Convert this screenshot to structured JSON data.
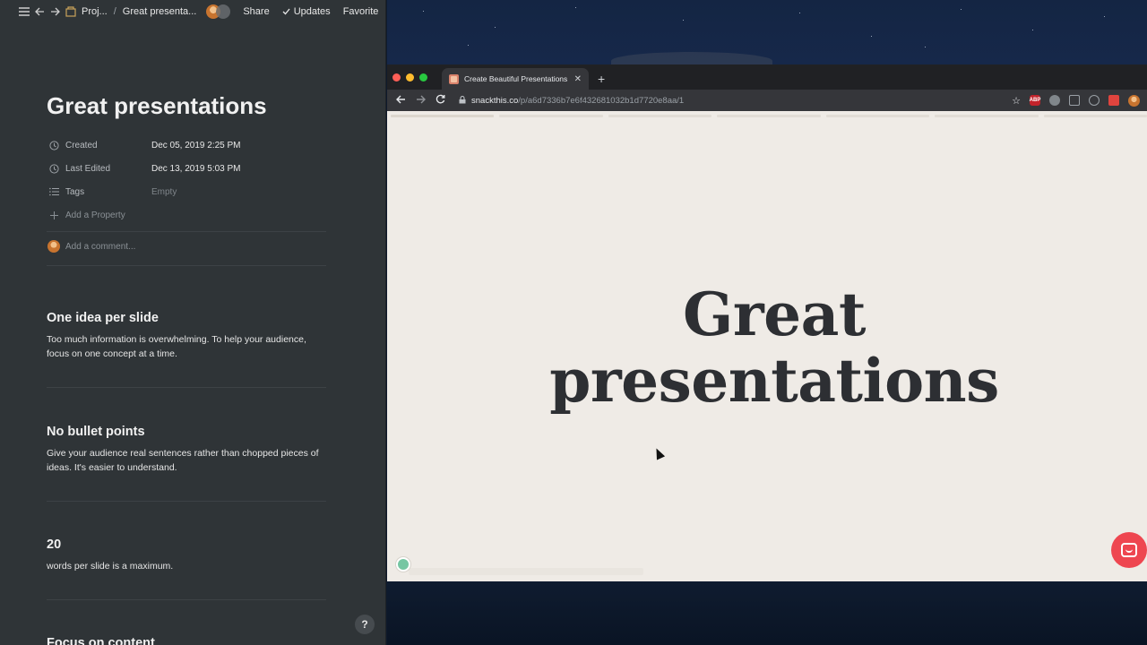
{
  "notion": {
    "breadcrumb": [
      "Proj...",
      "Great presenta..."
    ],
    "topbar_actions": {
      "share": "Share",
      "updates": "Updates",
      "favorite": "Favorite"
    },
    "page_title": "Great presentations",
    "properties": [
      {
        "icon": "clock-icon",
        "name": "Created",
        "value": "Dec 05, 2019 2:25 PM",
        "empty": false
      },
      {
        "icon": "clock-icon",
        "name": "Last Edited",
        "value": "Dec 13, 2019 5:03 PM",
        "empty": false
      },
      {
        "icon": "list-icon",
        "name": "Tags",
        "value": "Empty",
        "empty": true
      }
    ],
    "add_property": "Add a Property",
    "comment_placeholder": "Add a comment...",
    "blocks": [
      {
        "heading": "One idea per slide",
        "body": "Too much information is overwhelming. To help your audience, focus on one concept at a time."
      },
      {
        "heading": "No bullet points",
        "body": "Give your audience real sentences rather than chopped pieces of ideas. It's easier to understand."
      },
      {
        "heading": "20",
        "body": "words per slide is a maximum."
      },
      {
        "heading": "Focus on content",
        "body": ""
      }
    ],
    "help_label": "?"
  },
  "browser": {
    "tab_title": "Create Beautiful Presentations fr",
    "new_tab": "+",
    "url_domain": "snackthis.co",
    "url_path": "/p/a6d7336b7e6f432681032b1d7720e8aa/1",
    "extensions": [
      "ABP"
    ]
  },
  "slide": {
    "title_line1": "Great",
    "title_line2": "presentations"
  }
}
